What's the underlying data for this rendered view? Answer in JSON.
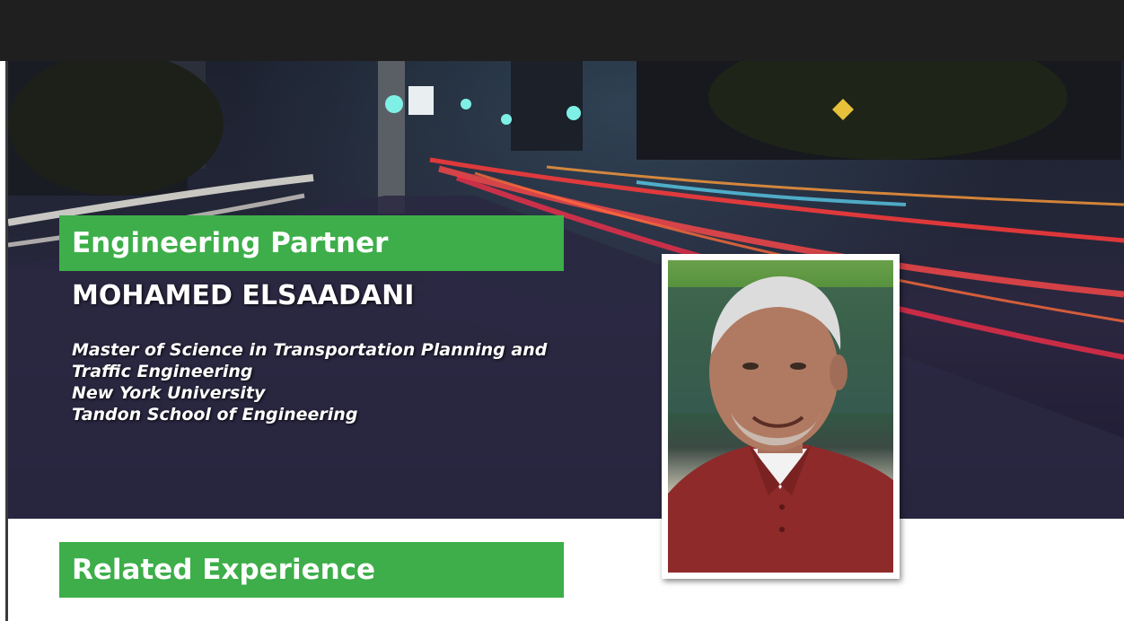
{
  "header": {
    "title": "Engineering Partner",
    "name": "MOHAMED ELSAADANI"
  },
  "credentials": {
    "lines": [
      "Master of Science in Transportation Planning and",
      "Traffic Engineering",
      "New York University",
      "Tandon School of Engineering"
    ]
  },
  "section": {
    "related_label": "Related Experience"
  },
  "colors": {
    "accent_green": "#3dae49",
    "top_bar": "#1f1f1f"
  },
  "images": {
    "hero": "night-city-street-light-trails",
    "portrait": "headshot-man-red-polo"
  }
}
